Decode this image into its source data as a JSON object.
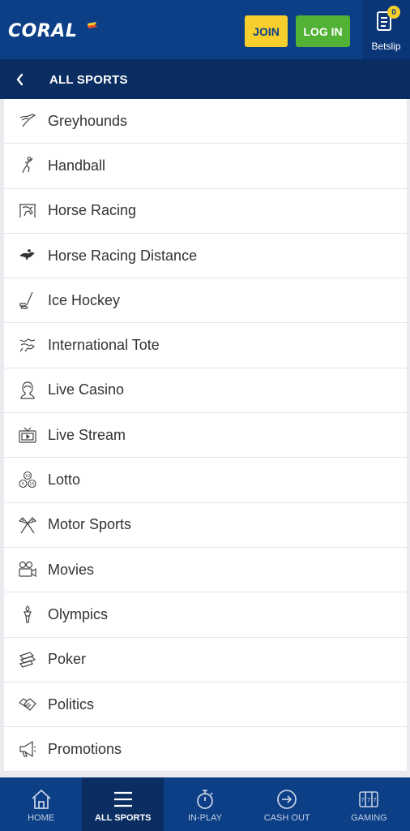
{
  "header": {
    "logo": "CORAL",
    "join_label": "JOIN",
    "login_label": "LOG IN",
    "betslip_label": "Betslip",
    "betslip_count": "0",
    "colors": {
      "header_bg": "#0c3f86",
      "join_bg": "#f7cf2c",
      "login_bg": "#52b236"
    }
  },
  "subheader": {
    "title": "ALL SPORTS"
  },
  "sports": [
    {
      "label": "Greyhounds",
      "icon": "greyhound-icon"
    },
    {
      "label": "Handball",
      "icon": "handball-icon"
    },
    {
      "label": "Horse Racing",
      "icon": "horse-racing-icon"
    },
    {
      "label": "Horse Racing Distance",
      "icon": "jockey-icon"
    },
    {
      "label": "Ice Hockey",
      "icon": "ice-hockey-icon"
    },
    {
      "label": "International Tote",
      "icon": "international-tote-icon"
    },
    {
      "label": "Live Casino",
      "icon": "live-casino-icon"
    },
    {
      "label": "Live Stream",
      "icon": "tv-icon"
    },
    {
      "label": "Lotto",
      "icon": "lotto-balls-icon"
    },
    {
      "label": "Motor Sports",
      "icon": "checkered-flags-icon"
    },
    {
      "label": "Movies",
      "icon": "movie-camera-icon"
    },
    {
      "label": "Olympics",
      "icon": "torch-icon"
    },
    {
      "label": "Poker",
      "icon": "poker-cards-icon"
    },
    {
      "label": "Politics",
      "icon": "handshake-icon"
    },
    {
      "label": "Promotions",
      "icon": "megaphone-icon"
    }
  ],
  "bottom_nav": [
    {
      "label": "HOME",
      "icon": "home-icon",
      "active": false
    },
    {
      "label": "ALL SPORTS",
      "icon": "menu-icon",
      "active": true
    },
    {
      "label": "IN-PLAY",
      "icon": "stopwatch-icon",
      "active": false
    },
    {
      "label": "CASH OUT",
      "icon": "cash-out-icon",
      "active": false
    },
    {
      "label": "GAMING",
      "icon": "slot-machine-icon",
      "active": false
    }
  ]
}
